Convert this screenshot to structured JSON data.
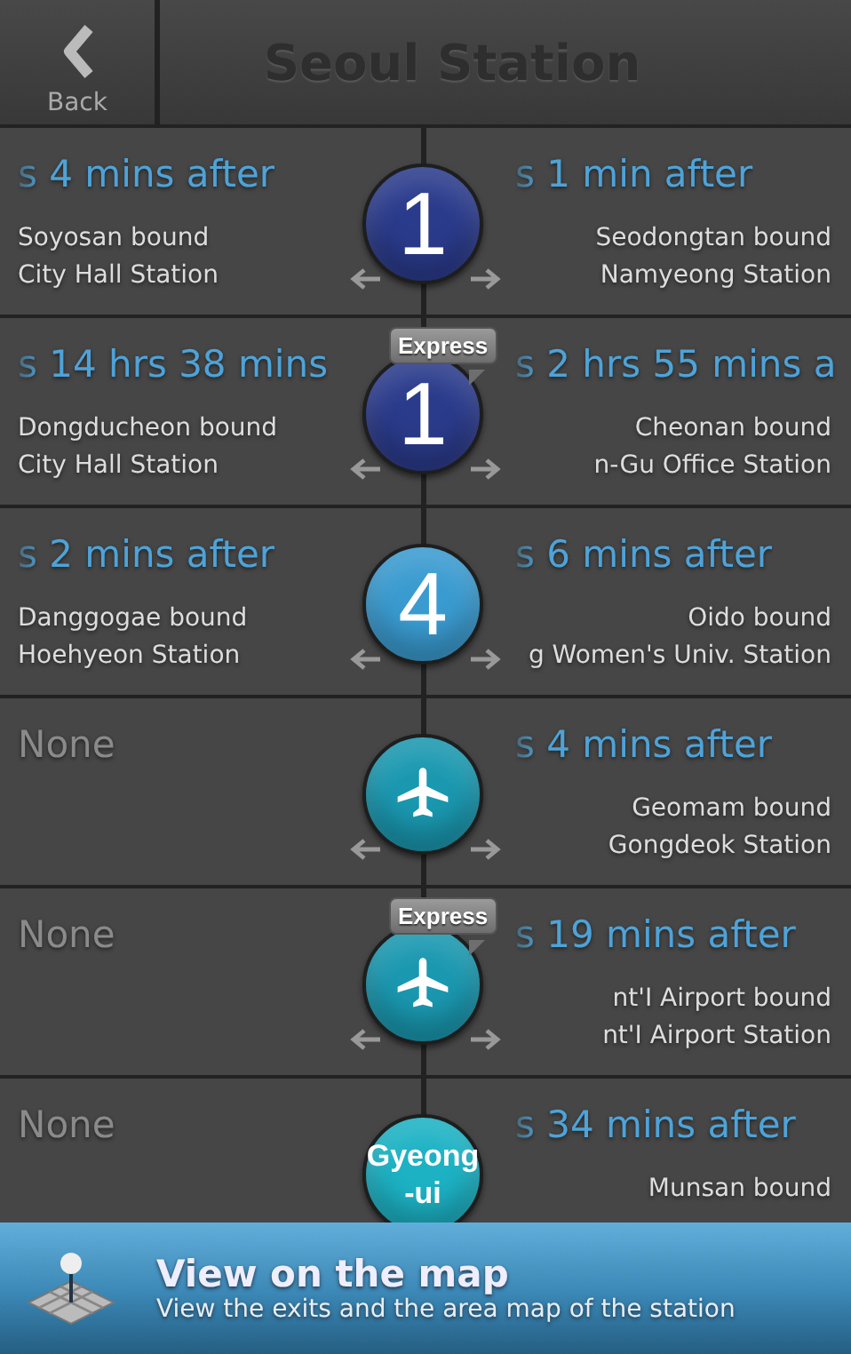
{
  "header": {
    "back_label": "Back",
    "title": "Seoul Station"
  },
  "rows": [
    {
      "badge": {
        "kind": "number",
        "label": "1",
        "color": "#2b3b8c"
      },
      "arrows": true,
      "left": {
        "kind": "train",
        "time": "s 4 mins after",
        "bound": "Soyosan bound",
        "station": "City Hall Station"
      },
      "right": {
        "kind": "train",
        "time": "s 1 min after",
        "bound": "Seodongtan bound",
        "station": "Namyeong Station"
      }
    },
    {
      "badge": {
        "kind": "number",
        "label": "1",
        "color": "#2b3b8c"
      },
      "express": "Express",
      "arrows": true,
      "left": {
        "kind": "train",
        "time": "s 14 hrs 38 mins",
        "bound": "Dongducheon bound",
        "station": "City Hall Station"
      },
      "right": {
        "kind": "train",
        "time": "s 2 hrs 55 mins a",
        "bound": "Cheonan bound",
        "station": "n-Gu Office Station"
      }
    },
    {
      "badge": {
        "kind": "number",
        "label": "4",
        "color": "#3a9bd0"
      },
      "arrows": true,
      "left": {
        "kind": "train",
        "time": "s 2 mins after",
        "bound": "Danggogae bound",
        "station": "Hoehyeon Station"
      },
      "right": {
        "kind": "train",
        "time": "s 6 mins after",
        "bound": "Oido bound",
        "station": "g Women's Univ. Station"
      }
    },
    {
      "badge": {
        "kind": "airport",
        "color": "#1a98b0"
      },
      "arrows": true,
      "left": {
        "kind": "none",
        "text": "None"
      },
      "right": {
        "kind": "train",
        "time": "s 4 mins after",
        "bound": "Geomam bound",
        "station": "Gongdeok Station"
      }
    },
    {
      "badge": {
        "kind": "airport",
        "color": "#1a98b0"
      },
      "express": "Express",
      "arrows": true,
      "left": {
        "kind": "none",
        "text": "None"
      },
      "right": {
        "kind": "train",
        "time": "s 19 mins after",
        "bound": "nt'I Airport bound",
        "station": "nt'I Airport Station"
      }
    },
    {
      "badge": {
        "kind": "text",
        "label": "Gyeong\n-ui",
        "color": "#1cb2c4"
      },
      "arrows": false,
      "left": {
        "kind": "none",
        "text": "None"
      },
      "right": {
        "kind": "train",
        "time": "s 34 mins after",
        "bound": "Munsan bound"
      }
    }
  ],
  "map_bar": {
    "title": "View on the map",
    "subtitle": "View the exits and the area map of the station"
  }
}
